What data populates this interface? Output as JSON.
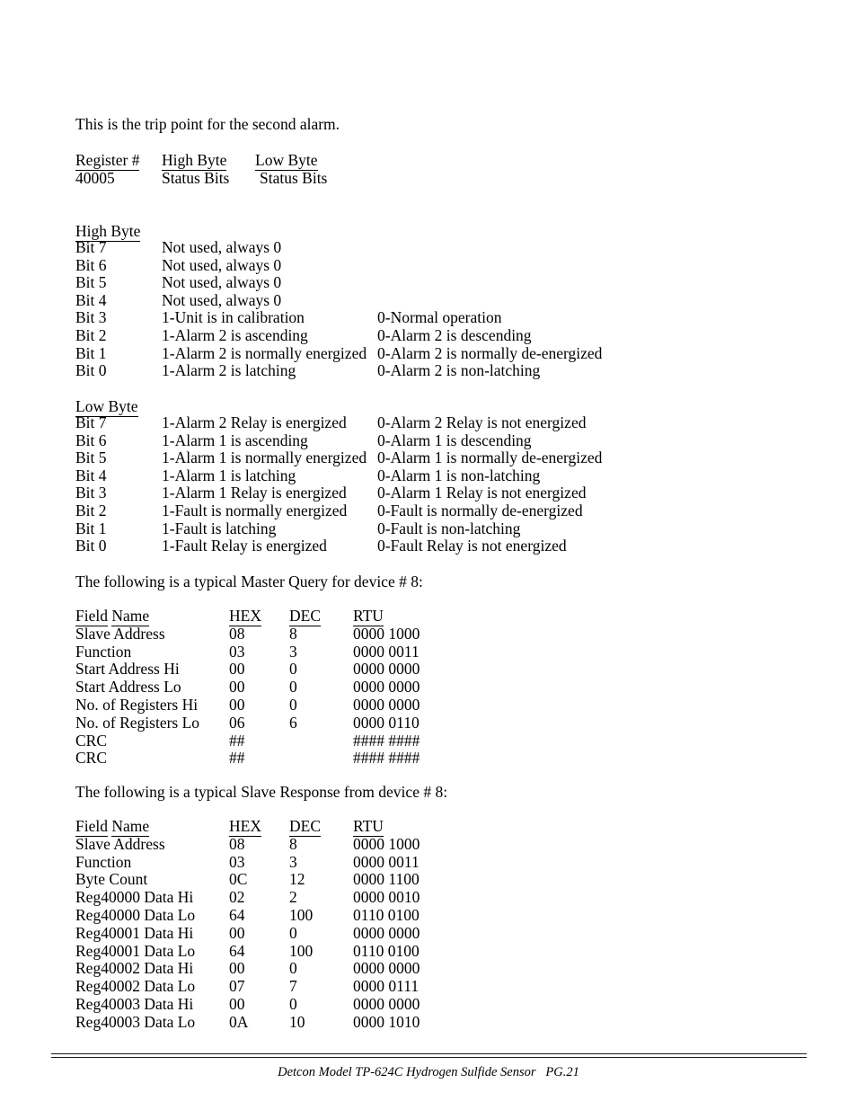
{
  "document": {
    "intro_line": "This is the trip point for the second alarm.",
    "master_query_line": "The following is a typical Master Query for device # 8:",
    "slave_response_line": "The following is a typical Slave Response from device # 8:"
  },
  "register_table": {
    "headers": [
      "Register #",
      "High Byte",
      "Low Byte"
    ],
    "row": [
      "40005",
      "Status Bits",
      "Status Bits"
    ]
  },
  "high_byte": {
    "heading": "High Byte",
    "rows": [
      {
        "bit": "Bit 7",
        "one": "Not used, always 0",
        "zero": ""
      },
      {
        "bit": "Bit 6",
        "one": "Not used, always 0",
        "zero": ""
      },
      {
        "bit": "Bit 5",
        "one": "Not used, always 0",
        "zero": ""
      },
      {
        "bit": "Bit 4",
        "one": "Not used, always 0",
        "zero": ""
      },
      {
        "bit": "Bit 3",
        "one": "1-Unit is in calibration",
        "zero": "0-Normal operation"
      },
      {
        "bit": "Bit 2",
        "one": "1-Alarm 2 is ascending",
        "zero": "0-Alarm 2 is descending"
      },
      {
        "bit": "Bit 1",
        "one": "1-Alarm 2 is normally energized",
        "zero": "0-Alarm 2 is normally de-energized"
      },
      {
        "bit": "Bit 0",
        "one": "1-Alarm 2 is latching",
        "zero": "0-Alarm 2 is non-latching"
      }
    ]
  },
  "low_byte": {
    "heading": "Low Byte",
    "rows": [
      {
        "bit": "Bit 7",
        "one": "1-Alarm 2 Relay is energized",
        "zero": "0-Alarm 2 Relay is not energized"
      },
      {
        "bit": "Bit 6",
        "one": "1-Alarm 1 is ascending",
        "zero": "0-Alarm 1 is descending"
      },
      {
        "bit": "Bit 5",
        "one": "1-Alarm 1 is normally energized",
        "zero": "0-Alarm 1 is normally de-energized"
      },
      {
        "bit": "Bit 4",
        "one": "1-Alarm 1 is latching",
        "zero": "0-Alarm 1 is non-latching"
      },
      {
        "bit": "Bit 3",
        "one": "1-Alarm 1 Relay is energized",
        "zero": "0-Alarm 1 Relay is not energized"
      },
      {
        "bit": "Bit 2",
        "one": "1-Fault is normally energized",
        "zero": "0-Fault is normally de-energized"
      },
      {
        "bit": "Bit 1",
        "one": "1-Fault is latching",
        "zero": "0-Fault is non-latching"
      },
      {
        "bit": "Bit 0",
        "one": "1-Fault Relay is energized",
        "zero": "0-Fault Relay is not energized"
      }
    ]
  },
  "master_query": {
    "headers": {
      "field": "Field",
      "name": "Name",
      "hex": "HEX",
      "dec": "DEC",
      "rtu": "RTU"
    },
    "rows": [
      {
        "name": "Slave Address",
        "hex": "08",
        "dec": "8",
        "rtu": "0000 1000"
      },
      {
        "name": "Function",
        "hex": "03",
        "dec": "3",
        "rtu": "0000 0011"
      },
      {
        "name": "Start Address Hi",
        "hex": "00",
        "dec": "0",
        "rtu": "0000 0000"
      },
      {
        "name": "Start Address Lo",
        "hex": "00",
        "dec": "0",
        "rtu": "0000 0000"
      },
      {
        "name": "No. of Registers Hi",
        "hex": "00",
        "dec": "0",
        "rtu": "0000 0000"
      },
      {
        "name": "No. of Registers Lo",
        "hex": "06",
        "dec": "6",
        "rtu": "0000 0110"
      },
      {
        "name": "CRC",
        "hex": "##",
        "dec": "",
        "rtu": "#### ####"
      },
      {
        "name": "CRC",
        "hex": "##",
        "dec": "",
        "rtu": "#### ####"
      }
    ]
  },
  "slave_response": {
    "headers": {
      "field": "Field",
      "name": "Name",
      "hex": "HEX",
      "dec": "DEC",
      "rtu": "RTU"
    },
    "rows": [
      {
        "name": "Slave Address",
        "hex": "08",
        "dec": "8",
        "rtu": "0000 1000"
      },
      {
        "name": "Function",
        "hex": "03",
        "dec": "3",
        "rtu": "0000 0011"
      },
      {
        "name": "Byte Count",
        "hex": "0C",
        "dec": "12",
        "rtu": "0000 1100"
      },
      {
        "name": "Reg40000 Data Hi",
        "hex": "02",
        "dec": "2",
        "rtu": "0000 0010"
      },
      {
        "name": "Reg40000 Data Lo",
        "hex": "64",
        "dec": "100",
        "rtu": "0110 0100"
      },
      {
        "name": "Reg40001 Data Hi",
        "hex": "00",
        "dec": "0",
        "rtu": "0000 0000"
      },
      {
        "name": "Reg40001 Data Lo",
        "hex": "64",
        "dec": "100",
        "rtu": "0110 0100"
      },
      {
        "name": "Reg40002 Data Hi",
        "hex": "00",
        "dec": "0",
        "rtu": "0000 0000"
      },
      {
        "name": "Reg40002 Data Lo",
        "hex": "07",
        "dec": "7",
        "rtu": "0000 0111"
      },
      {
        "name": "Reg40003 Data Hi",
        "hex": "00",
        "dec": "0",
        "rtu": "0000 0000"
      },
      {
        "name": "Reg40003 Data Lo",
        "hex": "0A",
        "dec": "10",
        "rtu": "0000 1010"
      }
    ]
  },
  "footer": {
    "text": "Detcon Model TP-624C Hydrogen Sulfide Sensor   PG.21"
  }
}
